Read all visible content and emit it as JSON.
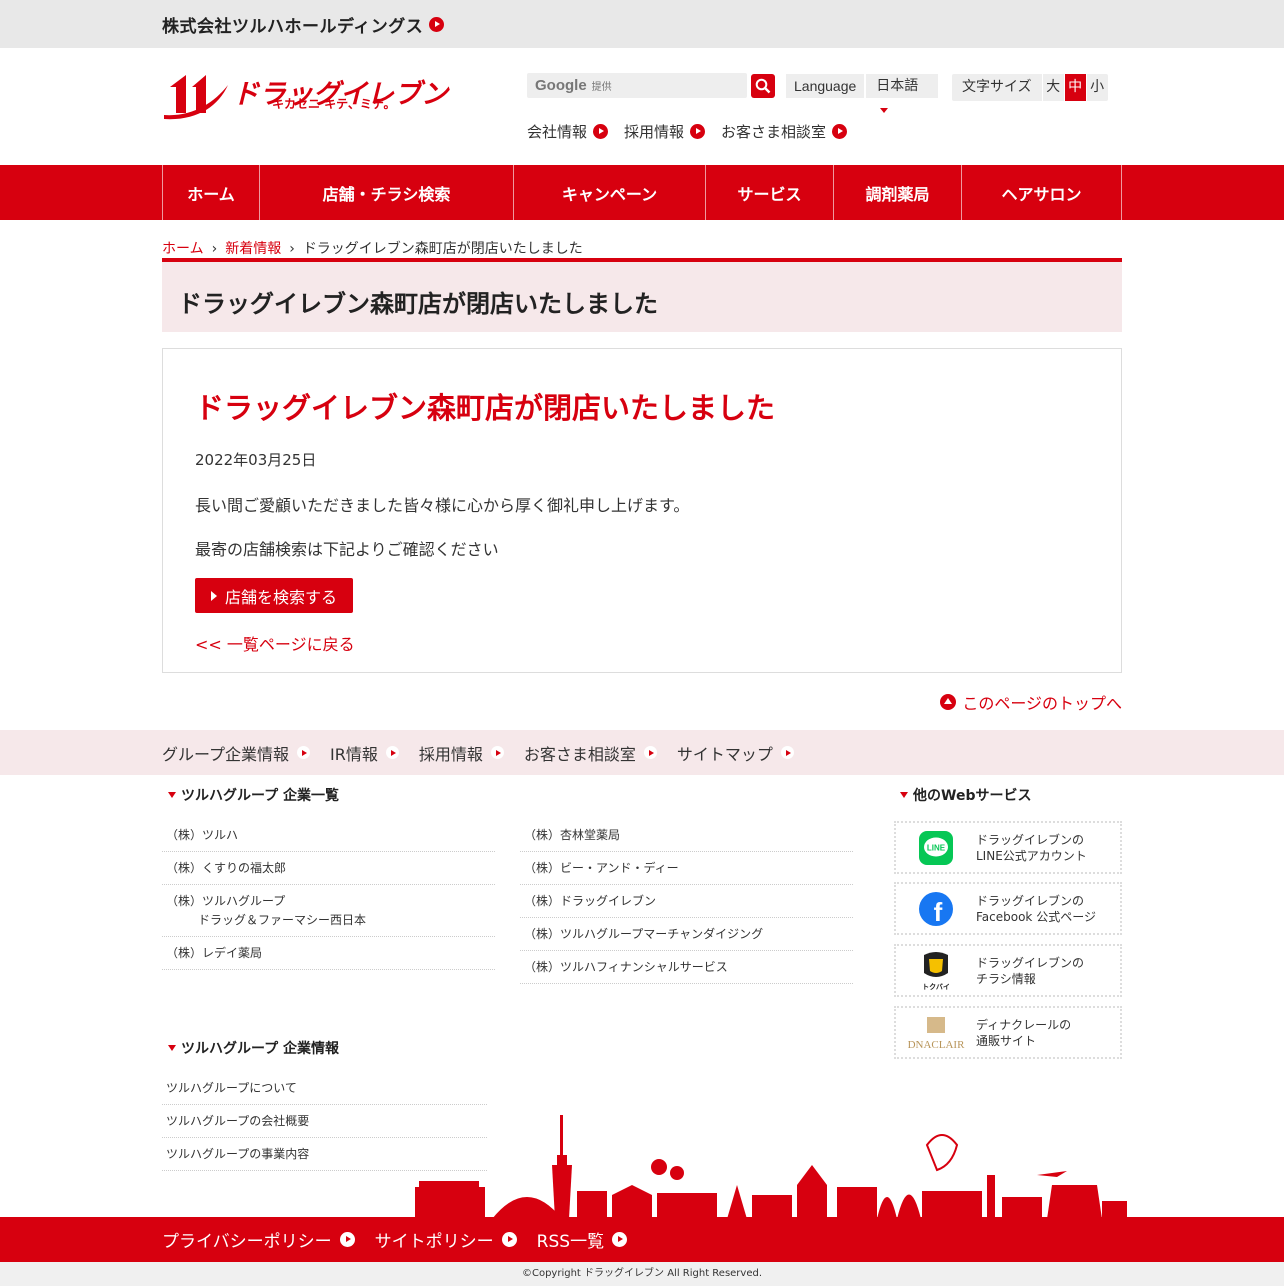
{
  "topbar": {
    "holdings": "株式会社ツルハホールディングス"
  },
  "header": {
    "logo_text": "ドラッグイレブン",
    "logo_tagline": "キカセニ キテ、ミテ。",
    "search": {
      "brand": "Google",
      "provided": "提供"
    },
    "language": {
      "label": "Language",
      "selected": "日本語"
    },
    "fontsize": {
      "label": "文字サイズ",
      "large": "大",
      "medium": "中",
      "small": "小",
      "active": "中"
    },
    "subnav": [
      "会社情報",
      "採用情報",
      "お客さま相談室"
    ]
  },
  "gnav": [
    "ホーム",
    "店舗・チラシ検索",
    "キャンペーン",
    "サービス",
    "調剤薬局",
    "ヘアサロン"
  ],
  "breadcrumb": {
    "home": "ホーム",
    "news": "新着情報",
    "current": "ドラッグイレブン森町店が閉店いたしました",
    "sep": "›"
  },
  "page_heading": "ドラッグイレブン森町店が閉店いたしました",
  "article": {
    "title": "ドラッグイレブン森町店が閉店いたしました",
    "date": "2022年03月25日",
    "p1": "長い間ご愛顧いただきました皆々様に心から厚く御礼申し上げます。",
    "p2": "最寄の店舗検索は下記よりご確認ください",
    "button": "店舗を検索する",
    "back": "<< 一覧ページに戻る"
  },
  "pagetop": "このページのトップへ",
  "footer_nav": [
    "グループ企業情報",
    "IR情報",
    "採用情報",
    "お客さま相談室",
    "サイトマップ"
  ],
  "group_companies": {
    "title": "ツルハグループ 企業一覧",
    "left": [
      {
        "line1": "（株）ツルハ",
        "line2": ""
      },
      {
        "line1": "（株）くすりの福太郎",
        "line2": ""
      },
      {
        "line1": "（株）ツルハグループ",
        "line2": "ドラッグ＆ファーマシー西日本"
      },
      {
        "line1": "（株）レデイ薬局",
        "line2": ""
      }
    ],
    "right": [
      "（株）杏林堂薬局",
      "（株）ビー・アンド・ディー",
      "（株）ドラッグイレブン",
      "（株）ツルハグループマーチャンダイジング",
      "（株）ツルハフィナンシャルサービス"
    ]
  },
  "group_info": {
    "title": "ツルハグループ 企業情報",
    "items": [
      "ツルハグループについて",
      "ツルハグループの会社概要",
      "ツルハグループの事業内容"
    ]
  },
  "web_services": {
    "title": "他のWebサービス",
    "cards": [
      {
        "icon": "line-icon",
        "badge": "LINE",
        "line1": "ドラッグイレブンの",
        "line2": "LINE公式アカウント"
      },
      {
        "icon": "facebook-icon",
        "badge": "f",
        "line1": "ドラッグイレブンの",
        "line2": "Facebook 公式ページ"
      },
      {
        "icon": "tokubai-icon",
        "badge": "トクバイ",
        "line1": "ドラッグイレブンの",
        "line2": "チラシ情報"
      },
      {
        "icon": "dnaclair-icon",
        "badge": "DNACLAIR",
        "line1": "ディナクレールの",
        "line2": "通販サイト"
      }
    ]
  },
  "bottom_links": [
    "プライバシーポリシー",
    "サイトポリシー",
    "RSS一覧"
  ],
  "copyright": "©Copyright ドラッグイレブン All Right Reserved.",
  "colors": {
    "brand_red": "#d7000f",
    "heading_bg": "#f6e8ea",
    "topbar_bg": "#e8e8e8"
  }
}
